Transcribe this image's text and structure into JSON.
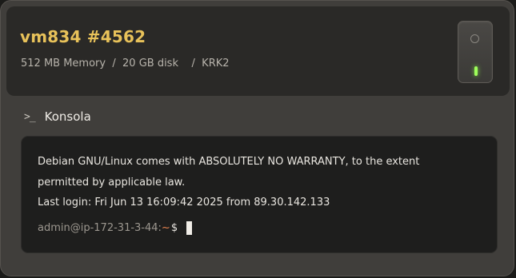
{
  "server": {
    "title": "vm834 #4562",
    "memory": "512 MB Memory",
    "disk": "20 GB disk",
    "location": "KRK2",
    "separator": "/"
  },
  "power": {
    "icon": "power-icon",
    "state_color": "#9eff5a"
  },
  "console": {
    "icon": "terminal-prompt-icon",
    "label": "Konsola"
  },
  "terminal": {
    "line1": "Debian GNU/Linux comes with ABSOLUTELY NO WARRANTY, to the extent",
    "line2": "permitted by applicable law.",
    "line3": "Last login: Fri Jun 13 16:09:42 2025 from 89.30.142.133",
    "prompt_user": "admin@ip-172-31-3-44:",
    "prompt_path": "~",
    "prompt_symbol": "$"
  },
  "colors": {
    "title_accent": "#e8c25a",
    "path_accent": "#e6834f"
  }
}
